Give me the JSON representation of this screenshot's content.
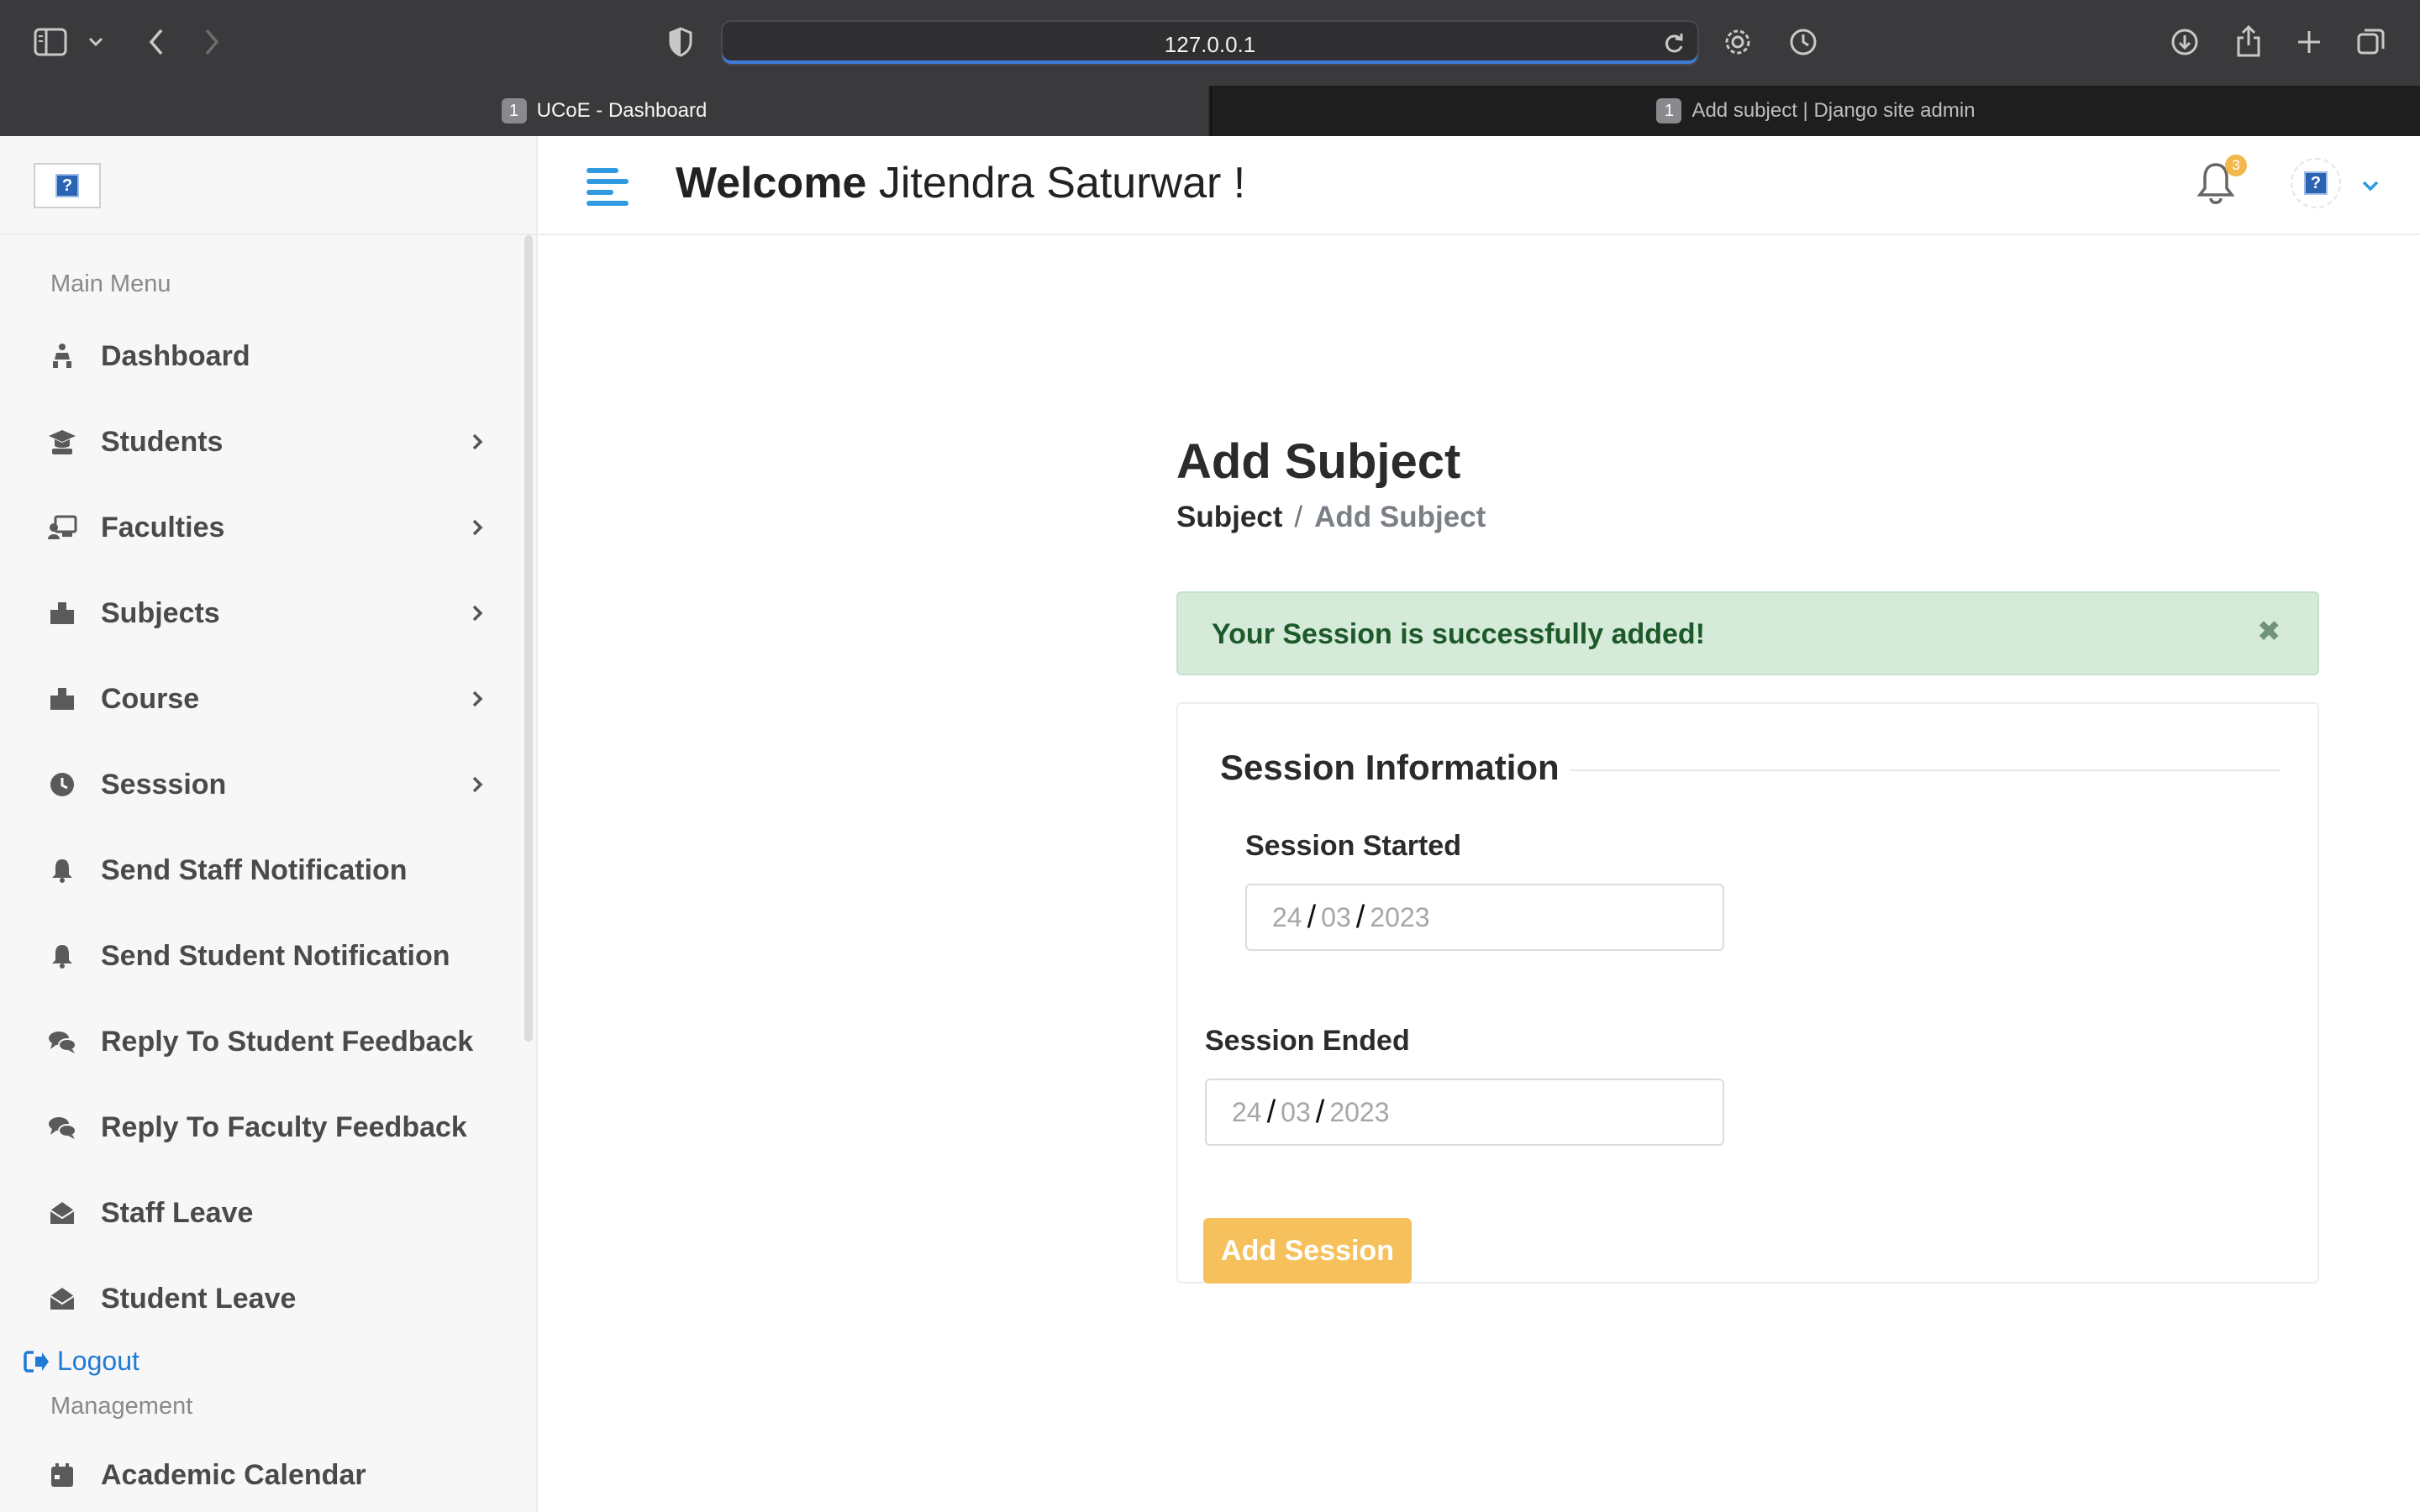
{
  "browser": {
    "url": "127.0.0.1",
    "tabs": [
      {
        "number": "1",
        "title": "UCoE - Dashboard",
        "active": true
      },
      {
        "number": "1",
        "title": "Add subject | Django site admin",
        "active": false
      }
    ]
  },
  "header": {
    "welcome_bold": "Welcome",
    "welcome_name": "Jitendra Saturwar  !",
    "notification_count": "3"
  },
  "sidebar": {
    "main_menu_title": "Main Menu",
    "items": [
      {
        "label": "Dashboard",
        "icon": "dashboard-icon",
        "has_submenu": false
      },
      {
        "label": "Students",
        "icon": "graduate-icon",
        "has_submenu": true
      },
      {
        "label": "Faculties",
        "icon": "teacher-icon",
        "has_submenu": true
      },
      {
        "label": "Subjects",
        "icon": "building-icon",
        "has_submenu": true
      },
      {
        "label": "Course",
        "icon": "building-icon",
        "has_submenu": true
      },
      {
        "label": "Sesssion",
        "icon": "clock-icon",
        "has_submenu": true
      },
      {
        "label": "Send Staff Notification",
        "icon": "bell-icon",
        "has_submenu": false
      },
      {
        "label": "Send Student Notification",
        "icon": "bell-icon",
        "has_submenu": false
      },
      {
        "label": "Reply To Student Feedback",
        "icon": "comments-icon",
        "has_submenu": false
      },
      {
        "label": "Reply To Faculty Feedback",
        "icon": "comments-icon",
        "has_submenu": false
      },
      {
        "label": "Staff Leave",
        "icon": "envelope-open-icon",
        "has_submenu": false
      },
      {
        "label": "Student Leave",
        "icon": "envelope-open-icon",
        "has_submenu": false
      }
    ],
    "logout_label": "Logout",
    "management_title": "Management",
    "management_items": [
      {
        "label": "Academic Calendar",
        "icon": "calendar-icon"
      }
    ]
  },
  "page": {
    "title": "Add Subject",
    "breadcrumb_parent": "Subject",
    "breadcrumb_separator": "/",
    "breadcrumb_current": "Add Subject",
    "alert_message": "Your Session is successfully added!",
    "alert_close": "✖",
    "section_title": "Session Information",
    "session_started_label": "Session Started",
    "session_started": {
      "day": "24",
      "month": "03",
      "year": "2023"
    },
    "session_ended_label": "Session Ended",
    "session_ended": {
      "day": "24",
      "month": "03",
      "year": "2023"
    },
    "date_separator": "/",
    "submit_label": "Add Session"
  },
  "colors": {
    "accent_blue": "#2f9ae0",
    "alert_green_bg": "#d6ead9",
    "button_yellow": "#f6c15c",
    "badge_yellow": "#f2b84b"
  }
}
